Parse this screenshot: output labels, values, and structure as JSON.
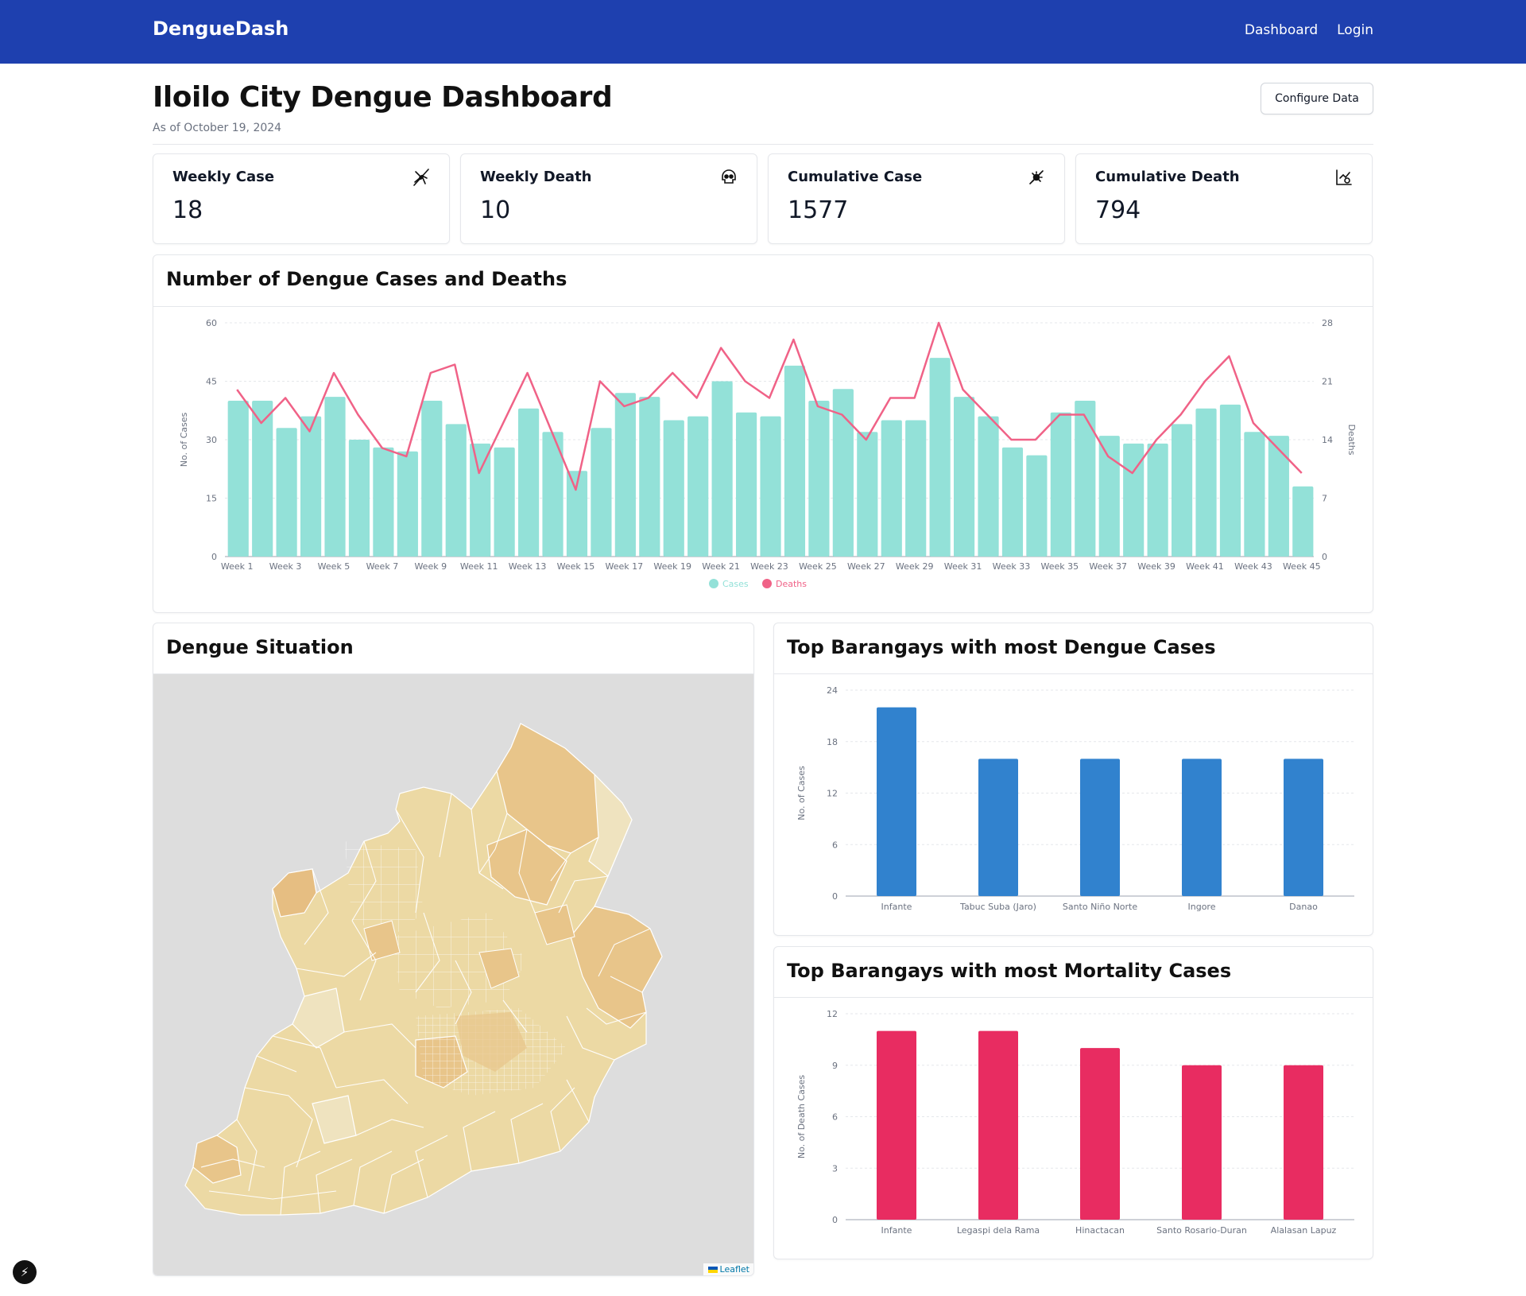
{
  "navbar": {
    "brand": "DengueDash",
    "links": [
      "Dashboard",
      "Login"
    ]
  },
  "header": {
    "title": "Iloilo City Dengue Dashboard",
    "as_of": "As of October 19, 2024",
    "configure_label": "Configure Data"
  },
  "stats": [
    {
      "title": "Weekly Case",
      "value": "18",
      "icon": "mosquito-icon"
    },
    {
      "title": "Weekly Death",
      "value": "10",
      "icon": "skull-icon"
    },
    {
      "title": "Cumulative Case",
      "value": "1577",
      "icon": "virus-icon"
    },
    {
      "title": "Cumulative Death",
      "value": "794",
      "icon": "chart-death-icon"
    }
  ],
  "cases_chart": {
    "title": "Number of Dengue Cases and Deaths",
    "chart_data": {
      "type": "bar",
      "categories": [
        "Week 1",
        "Week 2",
        "Week 3",
        "Week 4",
        "Week 5",
        "Week 6",
        "Week 7",
        "Week 8",
        "Week 9",
        "Week 10",
        "Week 11",
        "Week 12",
        "Week 13",
        "Week 14",
        "Week 15",
        "Week 16",
        "Week 17",
        "Week 18",
        "Week 19",
        "Week 20",
        "Week 21",
        "Week 22",
        "Week 23",
        "Week 24",
        "Week 25",
        "Week 26",
        "Week 27",
        "Week 28",
        "Week 29",
        "Week 30",
        "Week 31",
        "Week 32",
        "Week 33",
        "Week 34",
        "Week 35",
        "Week 36",
        "Week 37",
        "Week 38",
        "Week 39",
        "Week 40",
        "Week 41",
        "Week 42",
        "Week 43",
        "Week 44",
        "Week 45"
      ],
      "tick_labels": [
        "Week 1",
        "Week 3",
        "Week 5",
        "Week 7",
        "Week 9",
        "Week 11",
        "Week 13",
        "Week 15",
        "Week 17",
        "Week 19",
        "Week 21",
        "Week 23",
        "Week 25",
        "Week 27",
        "Week 29",
        "Week 31",
        "Week 33",
        "Week 35",
        "Week 37",
        "Week 39",
        "Week 41",
        "Week 43",
        "Week 45"
      ],
      "series": [
        {
          "name": "Cases",
          "type": "bar",
          "axis": "left",
          "color": "#93e1d8",
          "values": [
            40,
            40,
            33,
            36,
            41,
            30,
            28,
            27,
            40,
            34,
            29,
            28,
            38,
            32,
            22,
            33,
            42,
            41,
            35,
            36,
            45,
            37,
            36,
            49,
            40,
            43,
            32,
            35,
            35,
            51,
            41,
            36,
            28,
            26,
            37,
            40,
            31,
            29,
            29,
            34,
            38,
            39,
            32,
            31,
            18
          ]
        },
        {
          "name": "Deaths",
          "type": "line",
          "axis": "right",
          "color": "#f06287",
          "values": [
            20,
            16,
            19,
            15,
            22,
            17,
            13,
            12,
            22,
            23,
            10,
            16,
            22,
            15,
            8,
            21,
            18,
            19,
            22,
            19,
            25,
            21,
            19,
            26,
            18,
            17,
            14,
            19,
            19,
            28,
            20,
            17,
            14,
            14,
            17,
            17,
            12,
            10,
            14,
            17,
            21,
            24,
            16,
            13,
            10
          ]
        }
      ],
      "y_left": {
        "label": "No. of Cases",
        "min": 0,
        "max": 60,
        "ticks": [
          "0",
          "15",
          "30",
          "45",
          "60"
        ]
      },
      "y_right": {
        "label": "Deaths",
        "min": 0,
        "max": 28,
        "ticks": [
          "0",
          "7",
          "14",
          "21",
          "28"
        ]
      },
      "legend": "bottom-center",
      "grid": true
    }
  },
  "map": {
    "title": "Dengue Situation",
    "attribution": "Leaflet"
  },
  "top_cases": {
    "title": "Top Barangays with most Dengue Cases",
    "chart_data": {
      "type": "bar",
      "categories": [
        "Infante",
        "Tabuc Suba (Jaro)",
        "Santo Niño Norte",
        "Ingore",
        "Danao"
      ],
      "values": [
        22,
        16,
        16,
        16,
        16
      ],
      "ylabel": "No. of Cases",
      "ylim": [
        0,
        24
      ],
      "ticks": [
        "0",
        "6",
        "12",
        "18",
        "24"
      ],
      "color": "#3182ce",
      "grid": true
    }
  },
  "top_deaths": {
    "title": "Top Barangays with most Mortality Cases",
    "chart_data": {
      "type": "bar",
      "categories": [
        "Infante",
        "Legaspi dela Rama",
        "Hinactacan",
        "Santo Rosario-Duran",
        "Alalasan Lapuz"
      ],
      "values": [
        11,
        11,
        10,
        9,
        9
      ],
      "ylabel": "No. of Death Cases",
      "ylim": [
        0,
        12
      ],
      "ticks": [
        "0",
        "3",
        "6",
        "9",
        "12"
      ],
      "color": "#e82c61",
      "grid": true
    }
  }
}
